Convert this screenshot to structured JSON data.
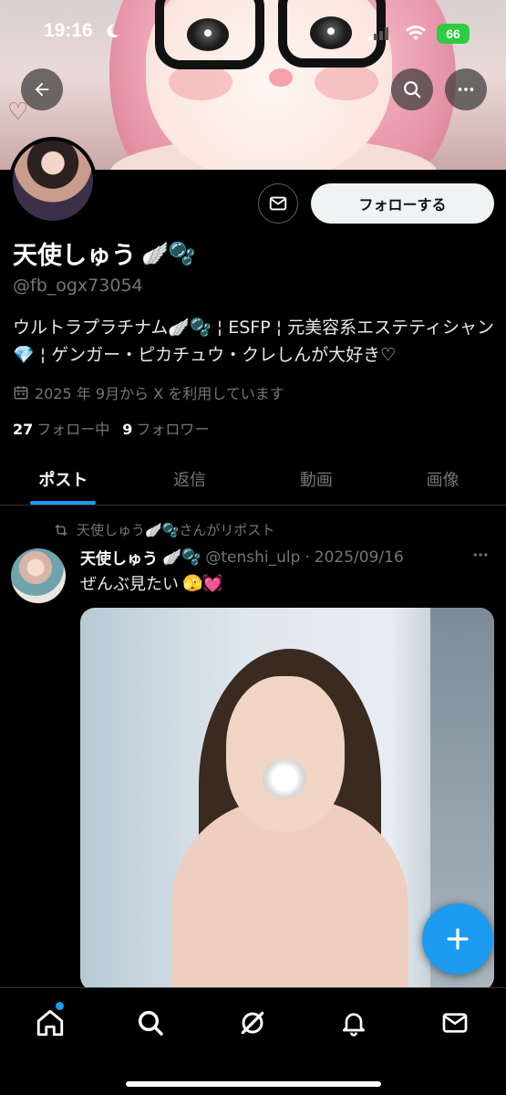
{
  "status_bar": {
    "time": "19:16",
    "battery": "66"
  },
  "profile": {
    "display_name": "天使しゅう",
    "handle": "@fb_ogx73054",
    "bio": "ウルトラプラチナム🪽🫧 ¦ ESFP ¦ 元美容系エステティシャン💎 ¦ ゲンガー・ピカチュウ・クレしんが大好き♡",
    "joined": "2025 年 9月から X を利用しています",
    "following_count": "27",
    "following_label": "フォロー中",
    "followers_count": "9",
    "followers_label": "フォロワー",
    "follow_button": "フォローする",
    "name_emoji": "🪽🫧"
  },
  "tabs": [
    {
      "label": "ポスト",
      "active": true
    },
    {
      "label": "返信",
      "active": false
    },
    {
      "label": "動画",
      "active": false
    },
    {
      "label": "画像",
      "active": false
    }
  ],
  "post": {
    "repost_label": "天使しゅう🪽🫧さんがリポスト",
    "author": "天使しゅう",
    "author_emoji": "🪽🫧",
    "author_handle": "@tenshi_ulp",
    "separator": "·",
    "date": "2025/09/16",
    "text": "ぜんぶ見たい",
    "text_emoji": "🫣💓"
  },
  "icons": {
    "back": "back-arrow-icon",
    "search": "search-icon",
    "more": "more-icon",
    "message": "message-icon",
    "calendar": "calendar-icon",
    "repost": "repost-icon",
    "home": "home-icon",
    "explore": "search-icon",
    "grok": "grok-icon",
    "notifications": "bell-icon",
    "messages": "mail-icon",
    "compose": "plus-icon"
  },
  "colors": {
    "accent": "#1d9bf0",
    "background": "#000000",
    "secondary_text": "#71767b",
    "battery": "#2ecc40"
  }
}
